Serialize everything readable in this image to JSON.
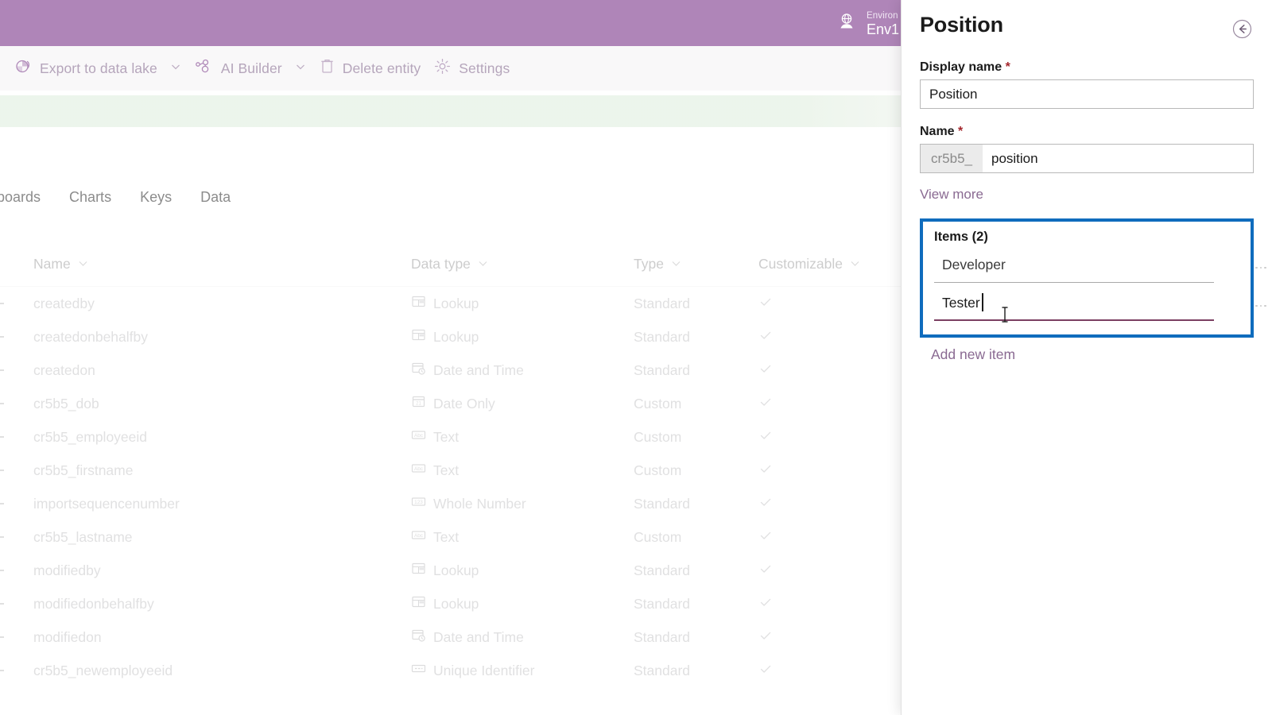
{
  "header": {
    "globe_icon": "globe-icon",
    "environment_label": "Environ",
    "environment_value": "Env1",
    "bar_color": "#AF85B8"
  },
  "command_bar": {
    "items": [
      {
        "label": "Export to data lake",
        "icon": "export-data-lake-icon",
        "has_caret": true
      },
      {
        "label": "AI Builder",
        "icon": "ai-builder-icon",
        "has_caret": true
      },
      {
        "label": "Delete entity",
        "icon": "trash-icon",
        "has_caret": false
      },
      {
        "label": "Settings",
        "icon": "gear-icon",
        "has_caret": false
      }
    ]
  },
  "tabs": [
    {
      "label": "boards"
    },
    {
      "label": "Charts"
    },
    {
      "label": "Keys"
    },
    {
      "label": "Data"
    }
  ],
  "grid": {
    "columns": [
      "Name",
      "Data type",
      "Type",
      "Customizable"
    ],
    "rows": [
      {
        "name": "createdby",
        "data_type": "Lookup",
        "dt_icon": "lookup-icon",
        "type": "Standard",
        "customizable": "✓"
      },
      {
        "name": "createdonbehalfby",
        "data_type": "Lookup",
        "dt_icon": "lookup-icon",
        "type": "Standard",
        "customizable": "✓"
      },
      {
        "name": "createdon",
        "data_type": "Date and Time",
        "dt_icon": "date-time-icon",
        "type": "Standard",
        "customizable": "✓"
      },
      {
        "name": "cr5b5_dob",
        "data_type": "Date Only",
        "dt_icon": "date-only-icon",
        "type": "Custom",
        "customizable": "✓"
      },
      {
        "name": "cr5b5_employeeid",
        "data_type": "Text",
        "dt_icon": "text-icon",
        "type": "Custom",
        "customizable": "✓"
      },
      {
        "name": "cr5b5_firstname",
        "data_type": "Text",
        "dt_icon": "text-icon",
        "type": "Custom",
        "customizable": "✓"
      },
      {
        "name": "importsequencenumber",
        "data_type": "Whole Number",
        "dt_icon": "whole-number-icon",
        "type": "Standard",
        "customizable": "✓"
      },
      {
        "name": "cr5b5_lastname",
        "data_type": "Text",
        "dt_icon": "text-icon",
        "type": "Custom",
        "customizable": "✓"
      },
      {
        "name": "modifiedby",
        "data_type": "Lookup",
        "dt_icon": "lookup-icon",
        "type": "Standard",
        "customizable": "✓"
      },
      {
        "name": "modifiedonbehalfby",
        "data_type": "Lookup",
        "dt_icon": "lookup-icon",
        "type": "Standard",
        "customizable": "✓"
      },
      {
        "name": "modifiedon",
        "data_type": "Date and Time",
        "dt_icon": "date-time-icon",
        "type": "Standard",
        "customizable": "✓"
      },
      {
        "name": "cr5b5_newemployeeid",
        "data_type": "Unique Identifier",
        "dt_icon": "unique-id-icon",
        "type": "Standard",
        "customizable": "✓"
      }
    ]
  },
  "panel": {
    "title": "Position",
    "back_icon": "back-arrow-icon",
    "display_name": {
      "label": "Display name",
      "required": "*",
      "value": "Position"
    },
    "name": {
      "label": "Name",
      "required": "*",
      "prefix": "cr5b5_",
      "value": "position"
    },
    "view_more": "View more",
    "items_section": {
      "title": "Items (2)",
      "focus_color": "#0F6CBD",
      "items": [
        {
          "value": "Developer",
          "active": false
        },
        {
          "value": "Tester",
          "active": true
        }
      ],
      "add_new_item": "Add new item"
    }
  }
}
